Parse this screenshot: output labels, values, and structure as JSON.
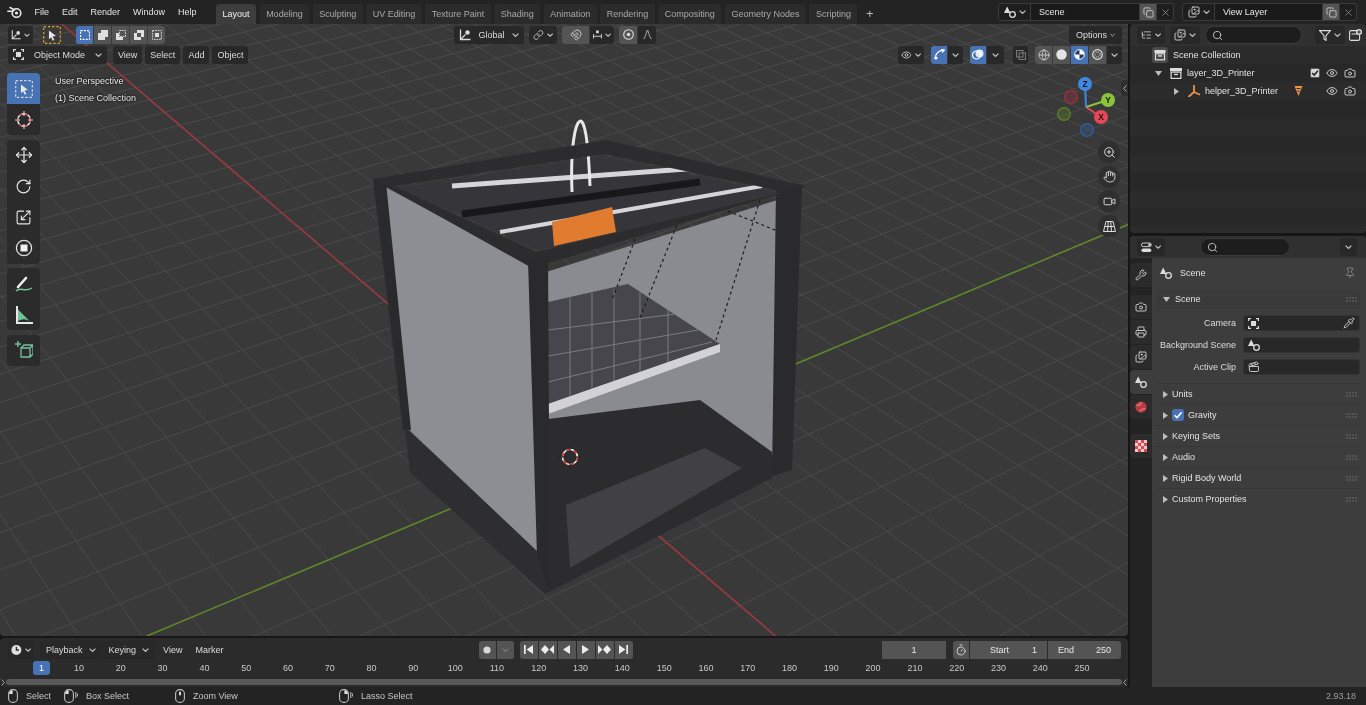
{
  "top_bar": {
    "menus": [
      "File",
      "Edit",
      "Render",
      "Window",
      "Help"
    ],
    "workspaces": [
      {
        "label": "Layout",
        "selected": true
      },
      {
        "label": "Modeling",
        "selected": false
      },
      {
        "label": "Sculpting",
        "selected": false
      },
      {
        "label": "UV Editing",
        "selected": false
      },
      {
        "label": "Texture Paint",
        "selected": false
      },
      {
        "label": "Shading",
        "selected": false
      },
      {
        "label": "Animation",
        "selected": false
      },
      {
        "label": "Rendering",
        "selected": false
      },
      {
        "label": "Compositing",
        "selected": false
      },
      {
        "label": "Geometry Nodes",
        "selected": false
      },
      {
        "label": "Scripting",
        "selected": false
      }
    ],
    "add_workspace": "+",
    "scene": "Scene",
    "view_layer": "View Layer"
  },
  "viewport": {
    "header": {
      "select_modes": [
        {
          "kind": "set",
          "selected": true
        },
        {
          "kind": "extend",
          "selected": false
        },
        {
          "kind": "subtract",
          "selected": false
        },
        {
          "kind": "difference",
          "selected": false
        },
        {
          "kind": "intersect",
          "selected": false
        }
      ],
      "orientation": "Global",
      "snap": false,
      "proportional_editing": false,
      "options": "Options",
      "mode": "Object Mode",
      "menus": [
        "View",
        "Select",
        "Add",
        "Object"
      ],
      "gizmos": true,
      "overlays": true,
      "xray": false,
      "shading": [
        {
          "kind": "wireframe",
          "selected": false
        },
        {
          "kind": "solid",
          "selected": false
        },
        {
          "kind": "material",
          "selected": true
        },
        {
          "kind": "rendered",
          "selected": false
        }
      ]
    },
    "overlay_text": [
      "User Perspective",
      "(1) Scene Collection"
    ],
    "toolbar": [
      {
        "tools": [
          {
            "kind": "select_box",
            "selected": true
          },
          {
            "kind": "cursor",
            "selected": false
          }
        ]
      },
      {
        "tools": [
          {
            "kind": "move",
            "selected": false
          },
          {
            "kind": "rotate",
            "selected": false
          },
          {
            "kind": "scale",
            "selected": false
          },
          {
            "kind": "transform",
            "selected": false
          }
        ]
      },
      {
        "tools": [
          {
            "kind": "annotate",
            "selected": false
          },
          {
            "kind": "measure",
            "selected": false
          }
        ]
      },
      {
        "tools": [
          {
            "kind": "add_cube",
            "selected": false
          }
        ]
      }
    ],
    "gizmo_axes": [
      "X",
      "Y",
      "Z"
    ]
  },
  "outliner": {
    "tree": [
      {
        "label": "Scene Collection",
        "kind": "scene_collection",
        "children": [
          {
            "label": "layer_3D_Printer",
            "kind": "collection",
            "expanded": true,
            "checked": true,
            "visible": true,
            "renderable": true,
            "children": [
              {
                "label": "helper_3D_Printer",
                "kind": "empty",
                "expanded": false,
                "visible": true,
                "renderable": true
              }
            ]
          }
        ]
      }
    ]
  },
  "properties": {
    "tab_groups": [
      {
        "tabs": [
          {
            "kind": "tool",
            "selected": false
          }
        ]
      },
      {
        "tabs": [
          {
            "kind": "render",
            "selected": false
          },
          {
            "kind": "output",
            "selected": false
          },
          {
            "kind": "view_layer",
            "selected": false
          },
          {
            "kind": "scene",
            "selected": true
          },
          {
            "kind": "world",
            "selected": false
          }
        ]
      },
      {
        "tabs": [
          {
            "kind": "texture",
            "selected": false
          }
        ]
      }
    ],
    "context": "Scene",
    "panel": {
      "title": "Scene",
      "expanded": true,
      "fields": [
        {
          "label": "Camera",
          "kind": "camera"
        },
        {
          "label": "Background Scene",
          "kind": "scene"
        },
        {
          "label": "Active Clip",
          "kind": "clip"
        }
      ]
    },
    "subpanels": [
      {
        "label": "Units",
        "expanded": false
      },
      {
        "label": "Gravity",
        "expanded": false,
        "checked": true
      },
      {
        "label": "Keying Sets",
        "expanded": false
      },
      {
        "label": "Audio",
        "expanded": false
      },
      {
        "label": "Rigid Body World",
        "expanded": false
      },
      {
        "label": "Custom Properties",
        "expanded": false
      }
    ]
  },
  "timeline": {
    "menus": [
      {
        "label": "Playback",
        "kind": "dropdown"
      },
      {
        "label": "Keying",
        "kind": "dropdown"
      },
      {
        "label": "View",
        "kind": "menu"
      },
      {
        "label": "Marker",
        "kind": "menu"
      }
    ],
    "auto_keying": false,
    "current_frame": "1",
    "start": {
      "label": "Start",
      "value": "1"
    },
    "end": {
      "label": "End",
      "value": "250"
    },
    "playhead": "1",
    "ruler": [
      "10",
      "20",
      "30",
      "40",
      "50",
      "60",
      "70",
      "80",
      "90",
      "100",
      "110",
      "120",
      "130",
      "140",
      "150",
      "160",
      "170",
      "180",
      "190",
      "200",
      "210",
      "220",
      "230",
      "240",
      "250"
    ]
  },
  "status_bar": {
    "hints": [
      {
        "kind": "click",
        "label": "Select"
      },
      {
        "kind": "drag",
        "label": "Box Select"
      },
      {
        "kind": "middle",
        "label": "Zoom View"
      },
      {
        "kind": "right_drag",
        "label": "Lasso Select"
      }
    ],
    "version": "2.93.18"
  }
}
